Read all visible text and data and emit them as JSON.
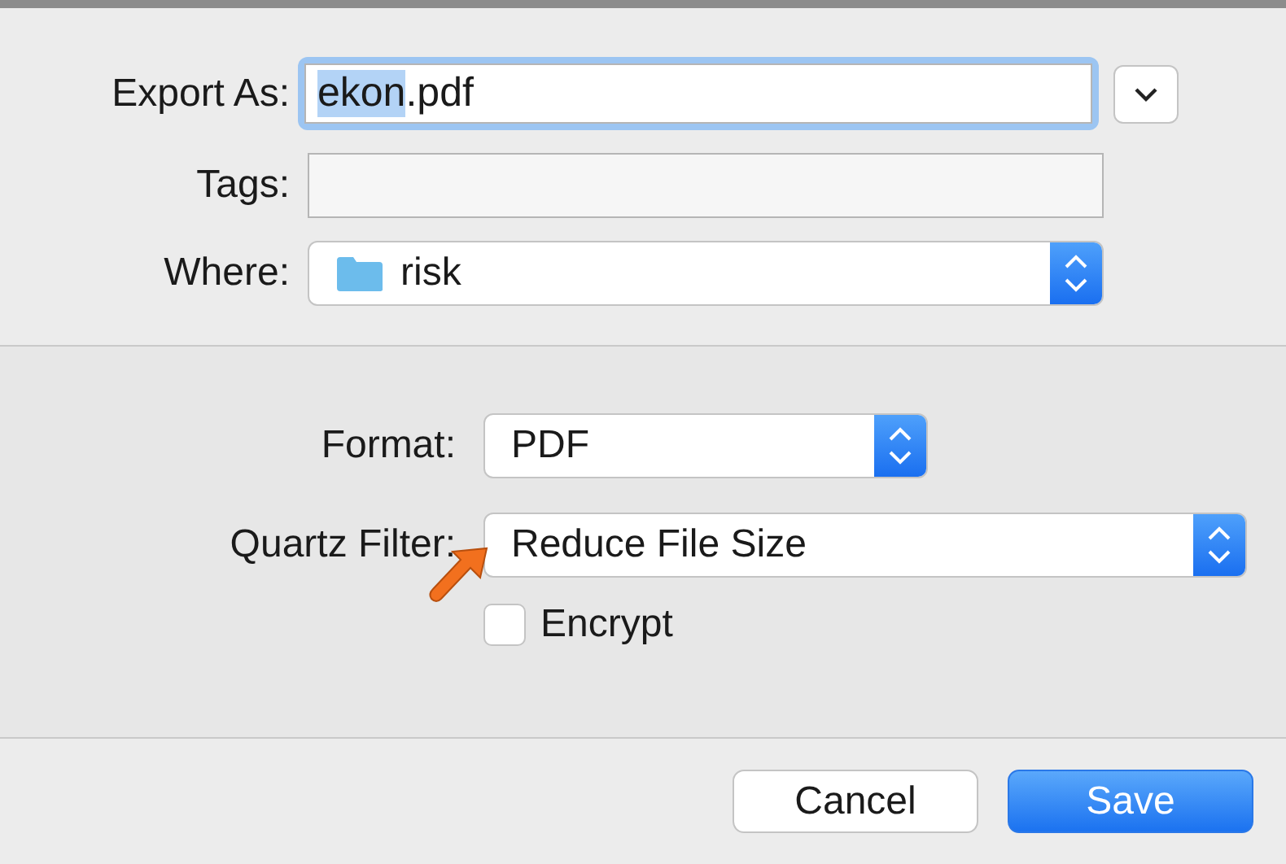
{
  "export_as": {
    "label": "Export As:",
    "selected_text": "ekon",
    "rest_text": ".pdf"
  },
  "tags": {
    "label": "Tags:"
  },
  "where": {
    "label": "Where:",
    "value": "risk"
  },
  "format": {
    "label": "Format:",
    "value": "PDF"
  },
  "quartz_filter": {
    "label": "Quartz Filter:",
    "value": "Reduce File Size",
    "annotated": true
  },
  "encrypt": {
    "label": "Encrypt",
    "checked": false
  },
  "buttons": [
    {
      "label": "Cancel",
      "default": false
    },
    {
      "label": "Save",
      "default": true
    }
  ]
}
